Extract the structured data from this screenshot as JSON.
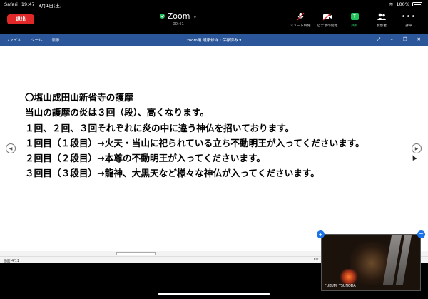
{
  "status_bar": {
    "carrier": "Safari",
    "time": "19:47",
    "date": "8月1日(土)",
    "battery": "100%"
  },
  "zoom": {
    "leave_label": "退出",
    "title": "Zoom",
    "timer": "00:41",
    "tools": [
      {
        "label": "ミュート解除",
        "icon": "mic-muted-icon"
      },
      {
        "label": "ビデオの開始",
        "icon": "video-off-icon"
      },
      {
        "label": "共有",
        "icon": "share-icon"
      },
      {
        "label": "参加者",
        "icon": "participants-icon"
      },
      {
        "label": "詳細",
        "icon": "more-icon"
      }
    ]
  },
  "app_bar": {
    "menus": [
      "ファイル",
      "ツール",
      "表示"
    ],
    "doc_title": "zoom用 護摩修祥・保存済み ▾",
    "win_btns": [
      "⤢",
      "–",
      "❐",
      "✕"
    ]
  },
  "document": {
    "lines": [
      "〇塩山成田山新省寺の護摩",
      "当山の護摩の炎は３回（段）、高くなります。",
      "１回、２回、３回それぞれに炎の中に違う神仏を招いております。",
      "１回目（１段目）→火天・当山に祀られている立ち不動明王が入ってくださいます。",
      "２回目（２段目）→本尊の不動明王が入ってくださいます。",
      "３回目（３段目）→龍神、大黒天など様々な神仏が入ってくださいます。"
    ]
  },
  "status_line": {
    "page": "画面 4/11",
    "zoom_fragment": "Ω2"
  },
  "self_video": {
    "name": "FUKUMI TSUNODA"
  },
  "colors": {
    "leave": "#e02828",
    "share": "#23c15a",
    "app_bar": "#2b579a",
    "badge": "#1a73e8"
  }
}
